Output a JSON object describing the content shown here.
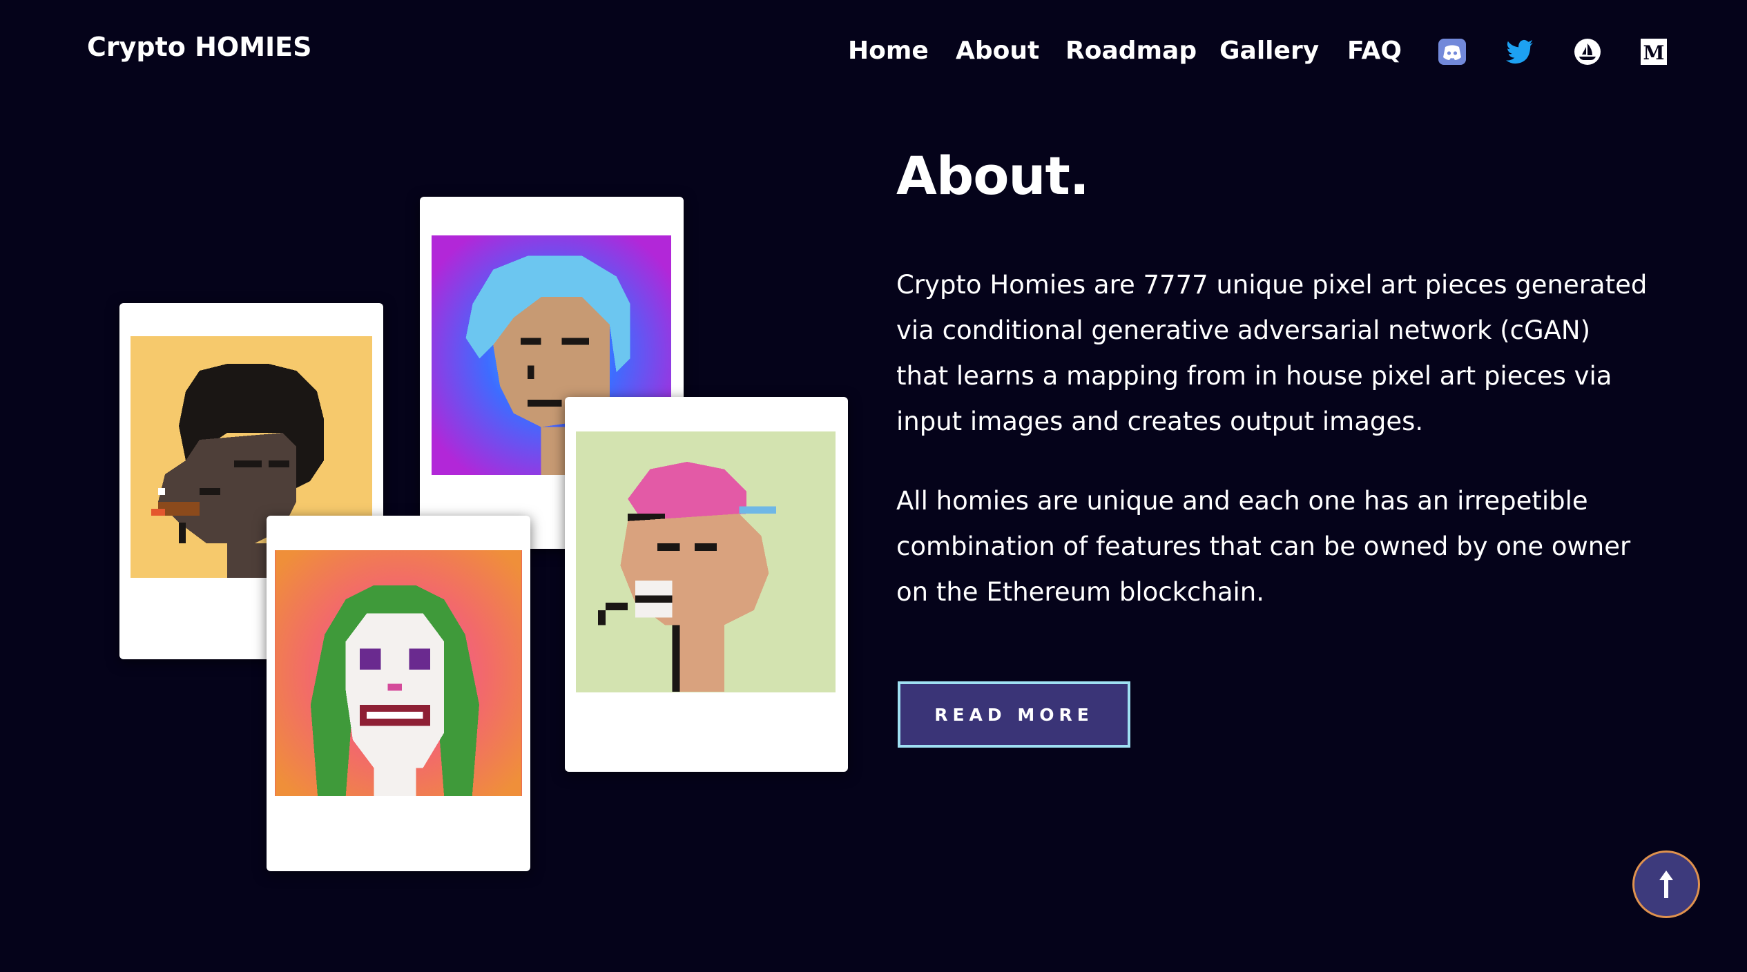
{
  "brand": {
    "logo": "Crypto HOMIES"
  },
  "nav": {
    "items": [
      {
        "label": "Home"
      },
      {
        "label": "About"
      },
      {
        "label": "Roadmap"
      },
      {
        "label": "Gallery"
      },
      {
        "label": "FAQ"
      }
    ],
    "social": [
      {
        "icon": "discord-icon",
        "color": "#7289da"
      },
      {
        "icon": "twitter-icon",
        "color": "#1da1f2"
      },
      {
        "icon": "opensea-icon",
        "color": "#ffffff"
      },
      {
        "icon": "medium-icon",
        "color": "#ffffff"
      }
    ]
  },
  "about": {
    "title": "About.",
    "paragraph_1": "Crypto Homies are 7777 unique pixel art pieces generated via conditional generative adversarial network (cGAN) that learns a mapping from in house pixel art pieces via input images and creates output images.",
    "paragraph_2": "All homies are unique and each one has an irrepetible combination of features that can be owned by one owner on the Ethereum blockchain.",
    "read_more_label": "READ MORE"
  },
  "gallery_cards": [
    {
      "name": "homie-afro-cigar",
      "bg": "#f6c96c"
    },
    {
      "name": "homie-blue-hair",
      "bg": "#8a4dd8"
    },
    {
      "name": "homie-joker",
      "bg": "#ec6a55"
    },
    {
      "name": "homie-pink-cap",
      "bg": "#d3e3b0"
    }
  ],
  "colors": {
    "background": "#05031a",
    "button_bg": "#3a3477",
    "button_border": "#9fe0f2",
    "scroll_top_border": "#e0924e"
  },
  "scroll_top": {
    "icon": "arrow-up-icon"
  }
}
